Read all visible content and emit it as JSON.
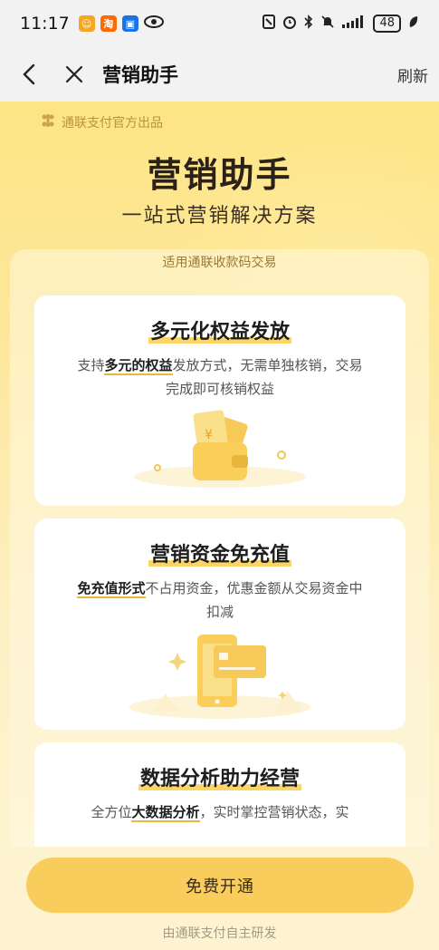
{
  "status_bar": {
    "time": "11:17",
    "battery": "48",
    "signal": "…▐▐▐"
  },
  "nav": {
    "title": "营销助手",
    "refresh_label": "刷新"
  },
  "hero": {
    "brand": "通联支付官方出品",
    "title": "营销助手",
    "subtitle": "一站式营销解决方案"
  },
  "panel": {
    "tag": "适用通联收款码交易"
  },
  "cards": [
    {
      "title": "多元化权益发放",
      "desc_prefix": "支持",
      "desc_highlight": "多元的权益",
      "desc_suffix": "发放方式，无需单独核销，交易完成即可核销权益"
    },
    {
      "title": "营销资金免充值",
      "desc_prefix": "",
      "desc_highlight": "免充值形式",
      "desc_suffix": "不占用资金，优惠金额从交易资金中扣减"
    },
    {
      "title": "数据分析助力经营",
      "desc_prefix": "全方位",
      "desc_highlight": "大数据分析",
      "desc_suffix": "，实时掌控营销状态，实"
    }
  ],
  "bottom": {
    "cta_label": "免费开通",
    "footer": "由通联支付自主研发"
  },
  "colors": {
    "accent": "#f8cd5c",
    "bg_top": "#fde585",
    "highlight": "#fbd565"
  }
}
